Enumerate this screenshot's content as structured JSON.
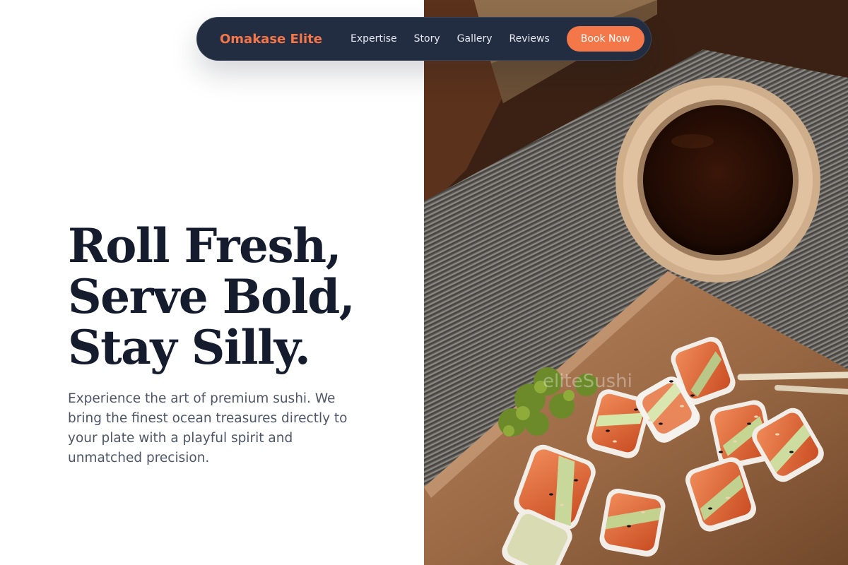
{
  "header": {
    "brand": "Omakase Elite",
    "nav_links": [
      "Expertise",
      "Story",
      "Gallery",
      "Reviews"
    ],
    "cta_label": "Book Now"
  },
  "hero": {
    "title_lines": [
      "Roll Fresh,",
      "Serve Bold,",
      "Stay Silly."
    ],
    "subtitle": "Experience the art of premium sushi. We bring the finest ocean treasures directly to your plate with a playful spirit and unmatched precision."
  },
  "image": {
    "watermark": "eliteSushi"
  },
  "colors": {
    "accent": "#f4774a",
    "nav_bg": "#232d42",
    "title": "#141c2e",
    "body_text": "#4d5666"
  }
}
